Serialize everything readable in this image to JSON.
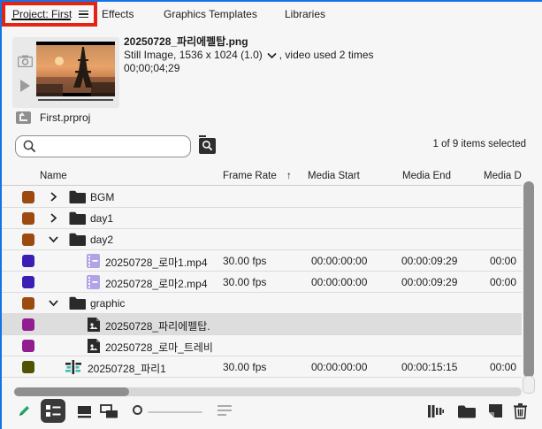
{
  "colors": {
    "focus_border": "#1473e6",
    "annotation_red": "#e42313",
    "swatch_folder": "#9c4a10",
    "swatch_clip": "#3c1eb4",
    "swatch_image": "#911d91",
    "swatch_sequence": "#4e5404",
    "selected_row": "#dddddd",
    "pencil_green": "#27a569"
  },
  "tabs": [
    {
      "label": "Project: First",
      "active": true,
      "annotated": true,
      "has_menu_icon": true
    },
    {
      "label": "Effects",
      "active": false
    },
    {
      "label": "Graphics Templates",
      "active": false
    },
    {
      "label": "Libraries",
      "active": false
    }
  ],
  "preview": {
    "title": "20250728_파리에펠탑.png",
    "info_left": "Still Image, 1536 x 1024 (1.0)",
    "info_right": ", video used 2 times",
    "duration": "00;00;04;29"
  },
  "breadcrumb": {
    "label": "First.prproj"
  },
  "search": {
    "value": "",
    "placeholder": ""
  },
  "status": {
    "selection": "1 of 9 items selected"
  },
  "table": {
    "columns": {
      "name": "Name",
      "frame_rate": "Frame Rate",
      "media_start": "Media Start",
      "media_end": "Media End",
      "media_duration": "Media D"
    },
    "sort_arrow": "↑",
    "rows": [
      {
        "name": "BGM",
        "type": "folder",
        "expanded": false,
        "selected": false,
        "frame_rate": "",
        "media_start": "",
        "media_end": "",
        "media_duration": ""
      },
      {
        "name": "day1",
        "type": "folder",
        "expanded": false,
        "selected": false,
        "frame_rate": "",
        "media_start": "",
        "media_end": "",
        "media_duration": ""
      },
      {
        "name": "day2",
        "type": "folder",
        "expanded": true,
        "selected": false,
        "frame_rate": "",
        "media_start": "",
        "media_end": "",
        "media_duration": ""
      },
      {
        "name": "20250728_로마1.mp4",
        "type": "clip",
        "selected": false,
        "frame_rate": "30.00 fps",
        "media_start": "00:00:00:00",
        "media_end": "00:00:09:29",
        "media_duration": "00:00"
      },
      {
        "name": "20250728_로마2.mp4",
        "type": "clip",
        "selected": false,
        "frame_rate": "30.00 fps",
        "media_start": "00:00:00:00",
        "media_end": "00:00:09:29",
        "media_duration": "00:00"
      },
      {
        "name": "graphic",
        "type": "folder",
        "expanded": true,
        "selected": false,
        "frame_rate": "",
        "media_start": "",
        "media_end": "",
        "media_duration": ""
      },
      {
        "name": "20250728_파리에펠탑.",
        "type": "image",
        "selected": true,
        "frame_rate": "",
        "media_start": "",
        "media_end": "",
        "media_duration": ""
      },
      {
        "name": "20250728_로마_트레비",
        "type": "image",
        "selected": false,
        "frame_rate": "",
        "media_start": "",
        "media_end": "",
        "media_duration": ""
      },
      {
        "name": "20250728_파리1",
        "type": "sequence",
        "selected": false,
        "frame_rate": "30.00 fps",
        "media_start": "00:00:00:00",
        "media_end": "00:00:15:15",
        "media_duration": "00:00"
      }
    ]
  },
  "toolbar": {
    "left_icons": [
      "project-writable",
      "list-view",
      "icon-view",
      "freeform-view",
      "zoom-slider",
      "sort-options"
    ],
    "right_icons": [
      "automate-to-sequence",
      "new-bin",
      "new-item",
      "delete"
    ]
  }
}
